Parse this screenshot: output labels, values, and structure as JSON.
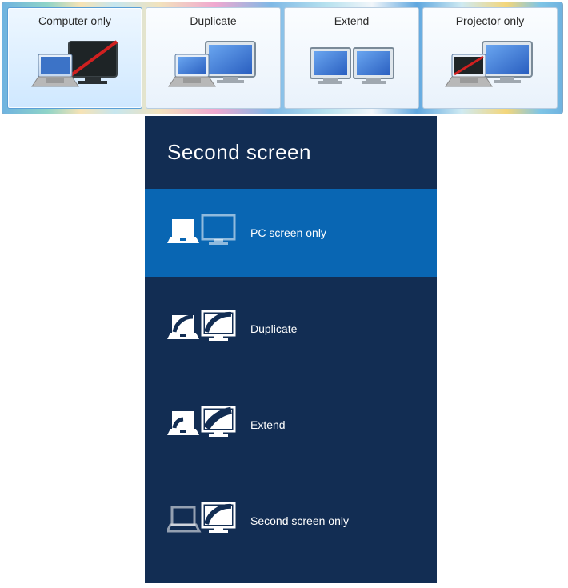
{
  "win7": {
    "options": [
      {
        "label": "Computer only",
        "selected": true
      },
      {
        "label": "Duplicate",
        "selected": false
      },
      {
        "label": "Extend",
        "selected": false
      },
      {
        "label": "Projector only",
        "selected": false
      }
    ]
  },
  "win8": {
    "title": "Second screen",
    "options": [
      {
        "label": "PC screen only",
        "selected": true
      },
      {
        "label": "Duplicate",
        "selected": false
      },
      {
        "label": "Extend",
        "selected": false
      },
      {
        "label": "Second screen only",
        "selected": false
      }
    ]
  }
}
